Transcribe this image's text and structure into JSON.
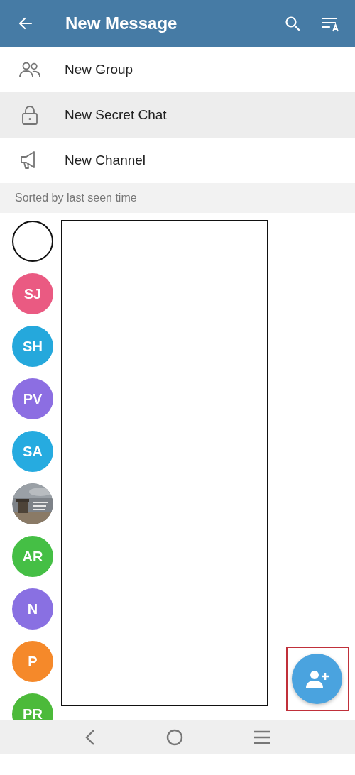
{
  "header": {
    "title": "New Message"
  },
  "actions": [
    {
      "kind": "group",
      "label": "New Group",
      "selected": false
    },
    {
      "kind": "secret",
      "label": "New Secret Chat",
      "selected": true
    },
    {
      "kind": "channel",
      "label": "New Channel",
      "selected": false
    }
  ],
  "section": "Sorted by last seen time",
  "contacts": [
    {
      "kind": "blank"
    },
    {
      "kind": "initials",
      "initials": "SJ",
      "color": "#ea5a82"
    },
    {
      "kind": "initials",
      "initials": "SH",
      "color": "#25a8dc"
    },
    {
      "kind": "initials",
      "initials": "PV",
      "color": "#8c6ee2"
    },
    {
      "kind": "initials",
      "initials": "SA",
      "color": "#26abe0"
    },
    {
      "kind": "picture"
    },
    {
      "kind": "initials",
      "initials": "AR",
      "color": "#45bf45"
    },
    {
      "kind": "initials",
      "initials": "N",
      "color": "#8970e2"
    },
    {
      "kind": "initials",
      "initials": "P",
      "color": "#f5892a"
    },
    {
      "kind": "initials",
      "initials": "PR",
      "color": "#4cba3a"
    }
  ]
}
